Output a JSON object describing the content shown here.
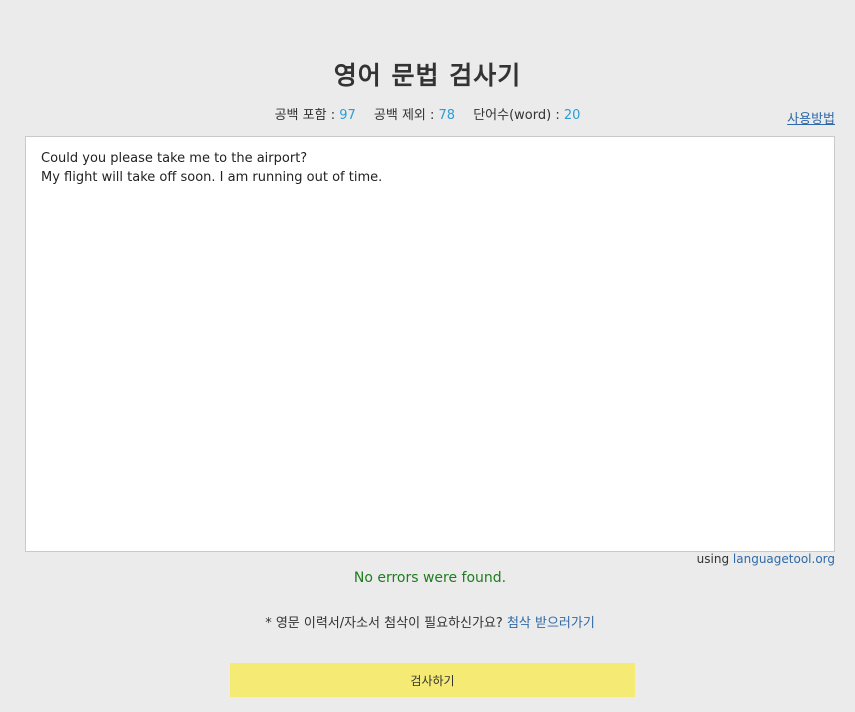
{
  "header": {
    "title": "영어 문법 검사기",
    "howto_link": "사용방법"
  },
  "stats": {
    "with_spaces_label": "공백 포함 : ",
    "with_spaces_value": "97",
    "without_spaces_label": "공백 제외 : ",
    "without_spaces_value": "78",
    "words_label": "단어수(word) : ",
    "words_value": "20"
  },
  "editor": {
    "lines": [
      "Could you please take me to the airport?",
      "My flight will take off soon. I am running out of time."
    ]
  },
  "attribution": {
    "prefix": "using ",
    "link": "languagetool.org"
  },
  "result": {
    "message": "No errors were found."
  },
  "promo": {
    "text": "* 영문 이력서/자소서 첨삭이 필요하신가요? ",
    "link": "첨삭 받으러가기"
  },
  "actions": {
    "check_label": "검사하기"
  },
  "colors": {
    "background": "#ebebeb",
    "count_accent": "#2a9fd6",
    "link": "#2f6aa8",
    "success": "#1e7d1e",
    "button": "#f5eb74"
  }
}
